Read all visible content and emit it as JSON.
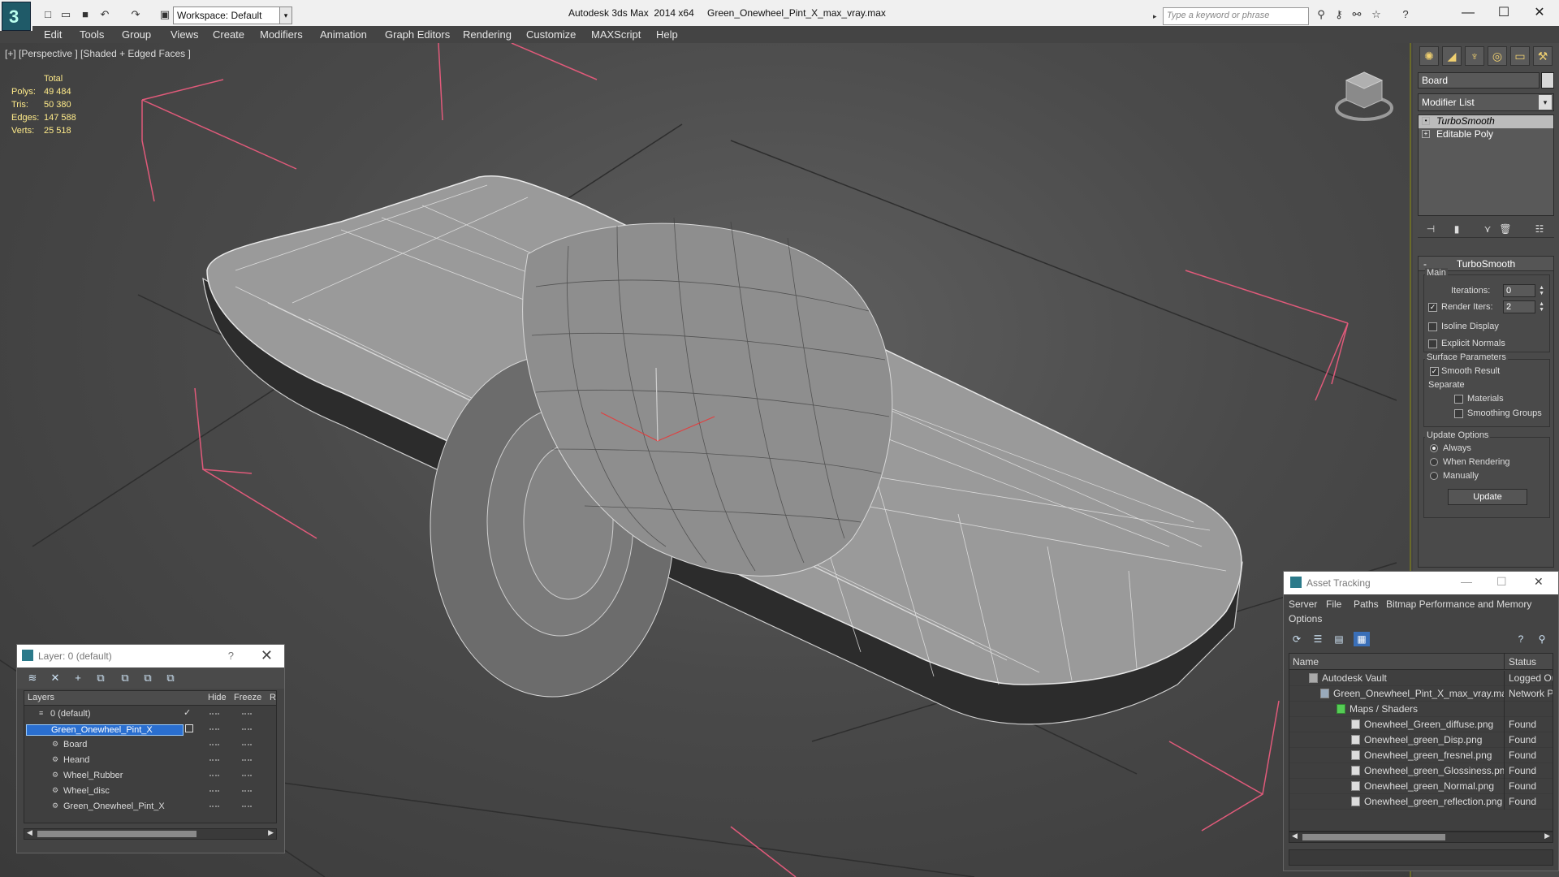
{
  "titlebar": {
    "app_title": "Autodesk 3ds Max  2014 x64",
    "document_title": "Green_Onewheel_Pint_X_max_vray.max",
    "workspace": "Workspace: Default",
    "search_placeholder": "Type a keyword or phrase"
  },
  "menu": [
    "Edit",
    "Tools",
    "Group",
    "Views",
    "Create",
    "Modifiers",
    "Animation",
    "Graph Editors",
    "Rendering",
    "Customize",
    "MAXScript",
    "Help"
  ],
  "viewport": {
    "label": "[+] [Perspective ] [Shaded + Edged Faces ]",
    "stats": {
      "header": "Total",
      "rows": [
        {
          "k": "Polys:",
          "v": "49 484"
        },
        {
          "k": "Tris:",
          "v": "50 380"
        },
        {
          "k": "Edges:",
          "v": "147 588"
        },
        {
          "k": "Verts:",
          "v": "25 518"
        }
      ]
    }
  },
  "command_panel": {
    "object_name": "Board",
    "modifier_list": "Modifier List",
    "stack": [
      "TurboSmooth",
      "Editable Poly"
    ],
    "rollout": {
      "title": "TurboSmooth",
      "main": "Main",
      "iterations_label": "Iterations:",
      "iterations_value": "0",
      "render_iters_label": "Render Iters:",
      "render_iters_value": "2",
      "isoline": "Isoline Display",
      "explicit_normals": "Explicit Normals",
      "surface_params": "Surface Parameters",
      "smooth_result": "Smooth Result",
      "separate": "Separate",
      "materials": "Materials",
      "smoothing_groups": "Smoothing Groups",
      "update_options": "Update Options",
      "always": "Always",
      "when_rendering": "When Rendering",
      "manually": "Manually",
      "update_button": "Update"
    }
  },
  "layer_dialog": {
    "title": "Layer: 0 (default)",
    "help": "?",
    "headers": {
      "layers": "Layers",
      "hide": "Hide",
      "freeze": "Freeze",
      "r": "R"
    },
    "rows": [
      {
        "name": "0 (default)",
        "level": 0
      },
      {
        "name": "Green_Onewheel_Pint_X",
        "level": 0
      },
      {
        "name": "Board",
        "level": 1
      },
      {
        "name": "Heand",
        "level": 1
      },
      {
        "name": "Wheel_Rubber",
        "level": 1
      },
      {
        "name": "Wheel_disc",
        "level": 1
      },
      {
        "name": "Green_Onewheel_Pint_X",
        "level": 1
      }
    ]
  },
  "asset_dialog": {
    "title": "Asset Tracking",
    "menu": [
      "Server",
      "File",
      "Paths",
      "Bitmap Performance and Memory",
      "Options"
    ],
    "headers": {
      "name": "Name",
      "status": "Status"
    },
    "rows": [
      {
        "name": "Autodesk Vault",
        "status": "Logged Out",
        "level": 1
      },
      {
        "name": "Green_Onewheel_Pint_X_max_vray.max",
        "status": "Network Path",
        "level": 2
      },
      {
        "name": "Maps / Shaders",
        "status": "",
        "level": 3
      },
      {
        "name": "Onewheel_Green_diffuse.png",
        "status": "Found",
        "level": 4
      },
      {
        "name": "Onewheel_green_Disp.png",
        "status": "Found",
        "level": 4
      },
      {
        "name": "Onewheel_green_fresnel.png",
        "status": "Found",
        "level": 4
      },
      {
        "name": "Onewheel_green_Glossiness.png",
        "status": "Found",
        "level": 4
      },
      {
        "name": "Onewheel_green_Normal.png",
        "status": "Found",
        "level": 4
      },
      {
        "name": "Onewheel_green_reflection.png",
        "status": "Found",
        "level": 4
      }
    ]
  }
}
